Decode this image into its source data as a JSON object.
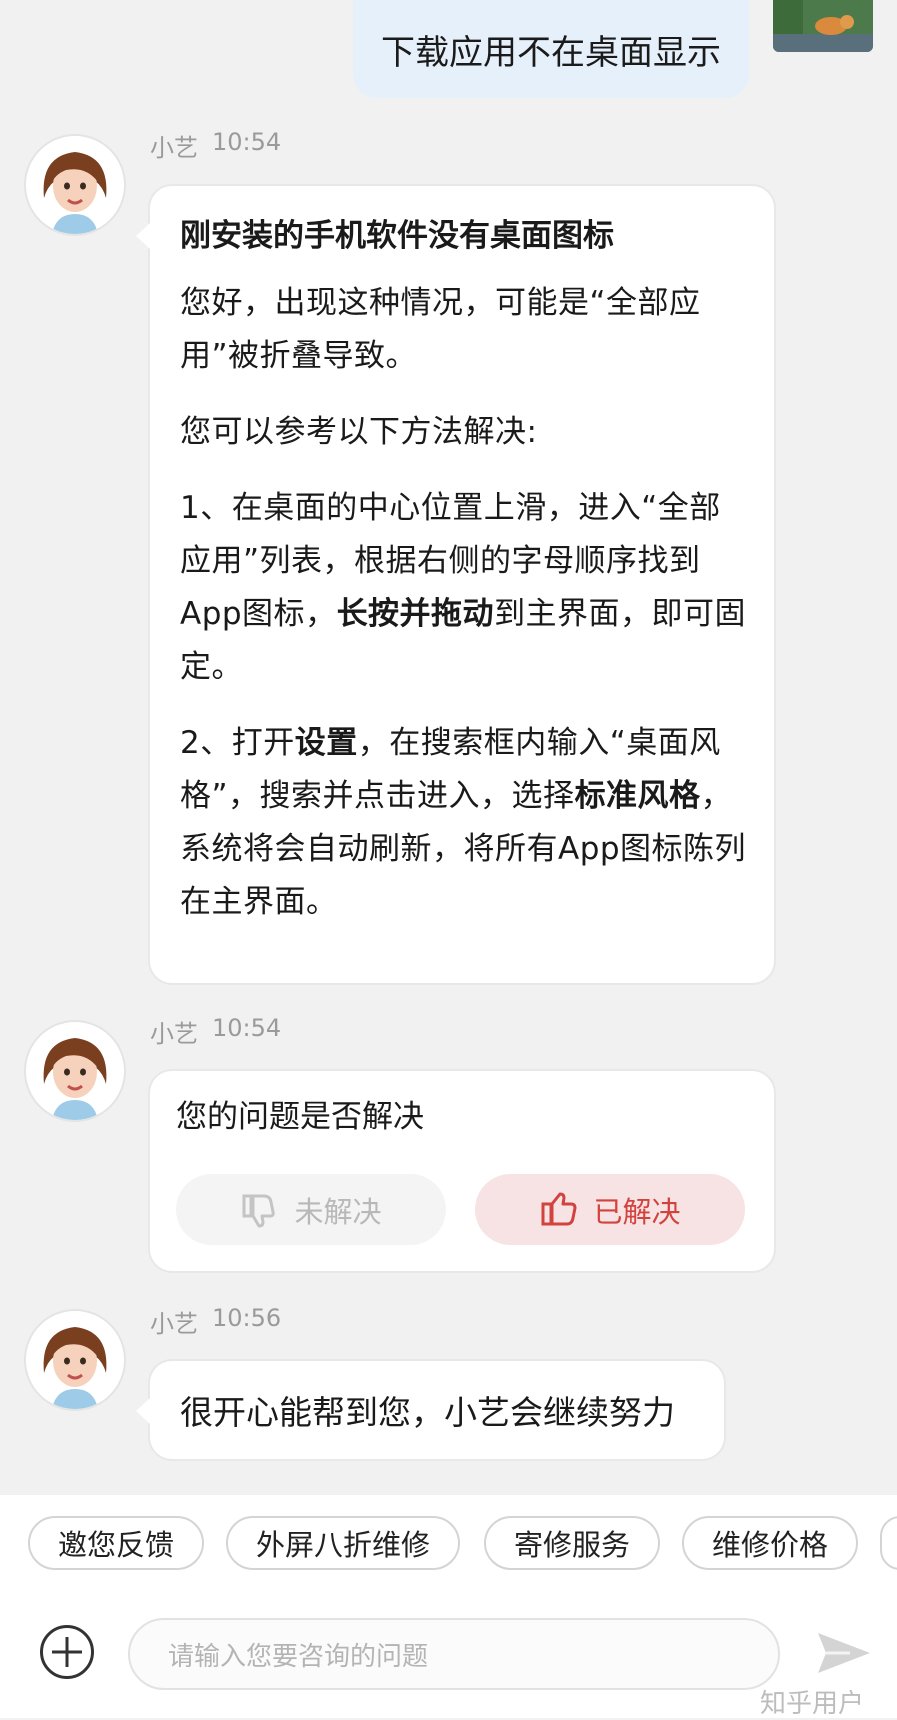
{
  "user_message": {
    "text": "下载应用不在桌面显示"
  },
  "messages": [
    {
      "sender": "小艺",
      "time": "10:54"
    },
    {
      "sender": "小艺",
      "time": "10:54"
    },
    {
      "sender": "小艺",
      "time": "10:56"
    }
  ],
  "answer": {
    "title": "刚安装的手机软件没有桌面图标",
    "p1": "您好，出现这种情况，可能是“全部应用”被折叠导致。",
    "p2": "您可以参考以下方法解决:",
    "p3_a": "1、在桌面的中心位置上滑，进入“全部应用”列表，根据右侧的字母顺序找到App图标，",
    "p3_bold": "长按并拖动",
    "p3_c": "到主界面，即可固定。",
    "p4_a": "2、打开",
    "p4_bold1": "设置",
    "p4_b": "，在搜索框内输入“桌面风格”，搜索并点击进入，选择",
    "p4_bold2": "标准风格",
    "p4_c": "，系统将会自动刷新，将所有App图标陈列在主界面。"
  },
  "feedback": {
    "question": "您的问题是否解决",
    "unresolved_label": "未解决",
    "resolved_label": "已解决",
    "colors": {
      "resolved": "#d2433f",
      "unresolved": "#b8b8b8"
    }
  },
  "reply": {
    "text": "很开心能帮到您，小艺会继续努力"
  },
  "quick_chips": [
    "邀您反馈",
    "外屏八折维修",
    "寄修服务",
    "维修价格"
  ],
  "input": {
    "placeholder": "请输入您要咨询的问题"
  },
  "watermark": "知乎用户",
  "icons": [
    "plus-circle-icon",
    "send-icon",
    "thumbs-down-icon",
    "thumbs-up-icon",
    "avatar-icon"
  ]
}
